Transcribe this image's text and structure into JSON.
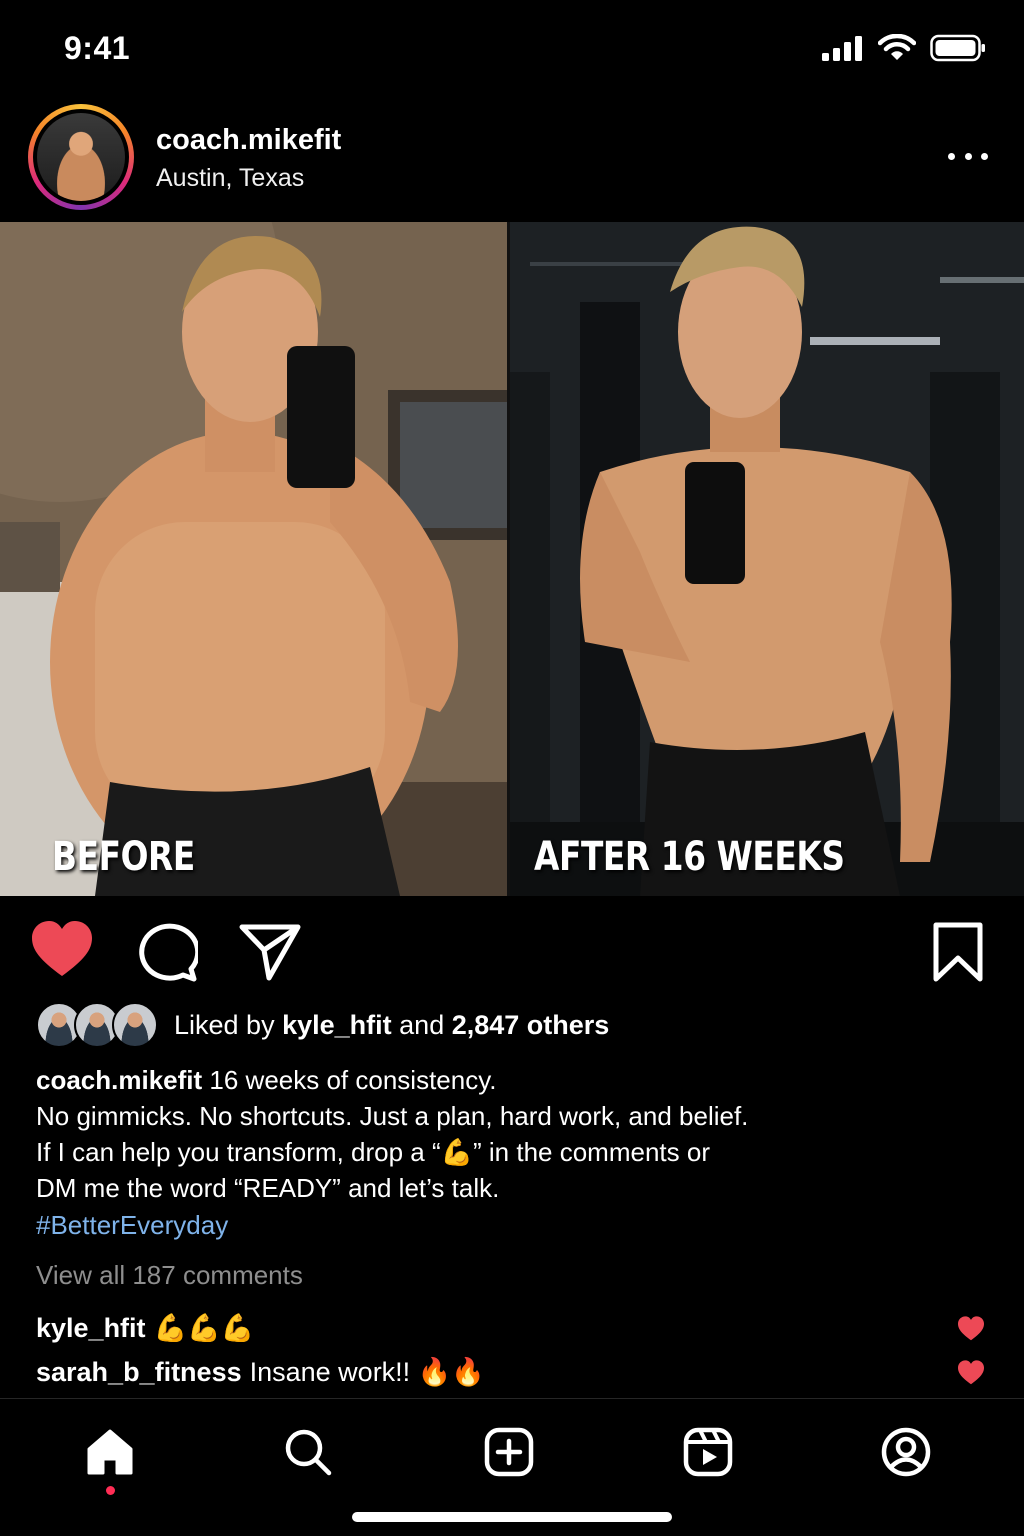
{
  "status_bar": {
    "time": "9:41"
  },
  "post": {
    "username": "coach.mikefit",
    "location": "Austin, Texas",
    "photos": [
      {
        "label": "BEFORE"
      },
      {
        "label": "AFTER 16 WEEKS"
      }
    ],
    "liked": true,
    "likes": {
      "prefix": "Liked by",
      "user": "kyle_hfit",
      "joiner": "and",
      "others": "2,847 others"
    },
    "caption": {
      "user": "coach.mikefit",
      "line1": "16 weeks of consistency.",
      "line2": "No gimmicks. No shortcuts. Just a plan, hard work, and belief.",
      "line3": "If I can help you transform, drop a “💪” in the comments or",
      "line4": "DM me the word “READY” and let’s talk.",
      "hashtag": "#BetterEveryday"
    },
    "view_comments": "View all 187 comments",
    "comments": [
      {
        "user": "kyle_hfit",
        "text": "💪💪💪"
      },
      {
        "user": "sarah_b_fitness",
        "text": "Insane work!! 🔥🔥"
      }
    ]
  },
  "colors": {
    "like_red": "#ed4956",
    "hashtag_blue": "#7fb3ea",
    "muted": "#8e8e8e"
  },
  "icons": [
    "signal-icon",
    "wifi-icon",
    "battery-icon",
    "more-icon",
    "heart-icon",
    "comment-icon",
    "share-icon",
    "bookmark-icon",
    "home-icon",
    "search-icon",
    "create-icon",
    "reels-icon",
    "profile-icon"
  ]
}
